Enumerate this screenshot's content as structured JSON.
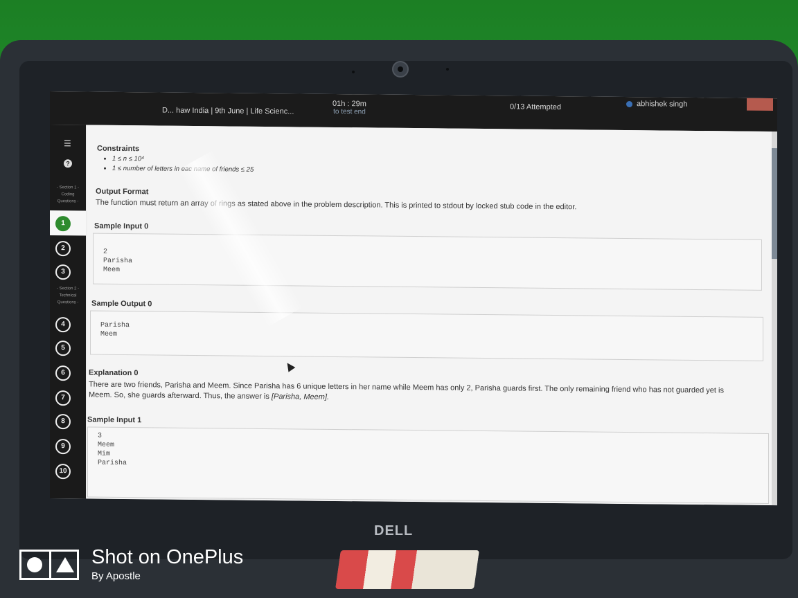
{
  "header": {
    "contest_title": "D... haw India | 9th June | Life Scienc...",
    "timer": "01h : 29m",
    "timer_sub": "to test end",
    "attempted": "0/13 Attempted",
    "user_name": "abhishek singh"
  },
  "sidebar": {
    "menu_icon": "list-icon",
    "help_icon": "question-icon",
    "section1": [
      "- Section 1 -",
      "Coding",
      "Questions -"
    ],
    "section2": [
      "- Section 2 -",
      "Technical",
      "Questions -"
    ],
    "questions": [
      "1",
      "2",
      "3",
      "4",
      "5",
      "6",
      "7",
      "8",
      "9",
      "10"
    ],
    "active_question": "1"
  },
  "problem": {
    "constraints_heading": "Constraints",
    "constraint1": "1 ≤ n ≤ 10⁴",
    "constraint2": "1 ≤ number of letters in eac  name of friends ≤ 25",
    "output_heading": "Output Format",
    "output_text": "The function must return an array of   rings as stated above in the problem description. This is printed to stdout by locked stub code in the editor.",
    "sample_input0_heading": "Sample Input 0",
    "sample_input0": "2\nParisha\nMeem",
    "sample_output0_heading": "Sample Output 0",
    "sample_output0": "Parisha\nMeem",
    "explanation0_heading": "Explanation 0",
    "explanation0_text": "There are two friends, Parisha and Meem. Since Parisha has 6 unique letters in her name while Meem has only 2, Parisha guards first. The only remaining friend who has not guarded yet is Meem. So, she guards afterward. Thus, the answer is ",
    "explanation0_answer": "[Parisha, Meem].",
    "sample_input1_heading": "Sample Input 1",
    "sample_input1": "3\nMeem\nMim\nParisha"
  },
  "laptop": {
    "brand": "DELL"
  },
  "watermark": {
    "title": "Shot on OnePlus",
    "sub": "By Apostle"
  }
}
